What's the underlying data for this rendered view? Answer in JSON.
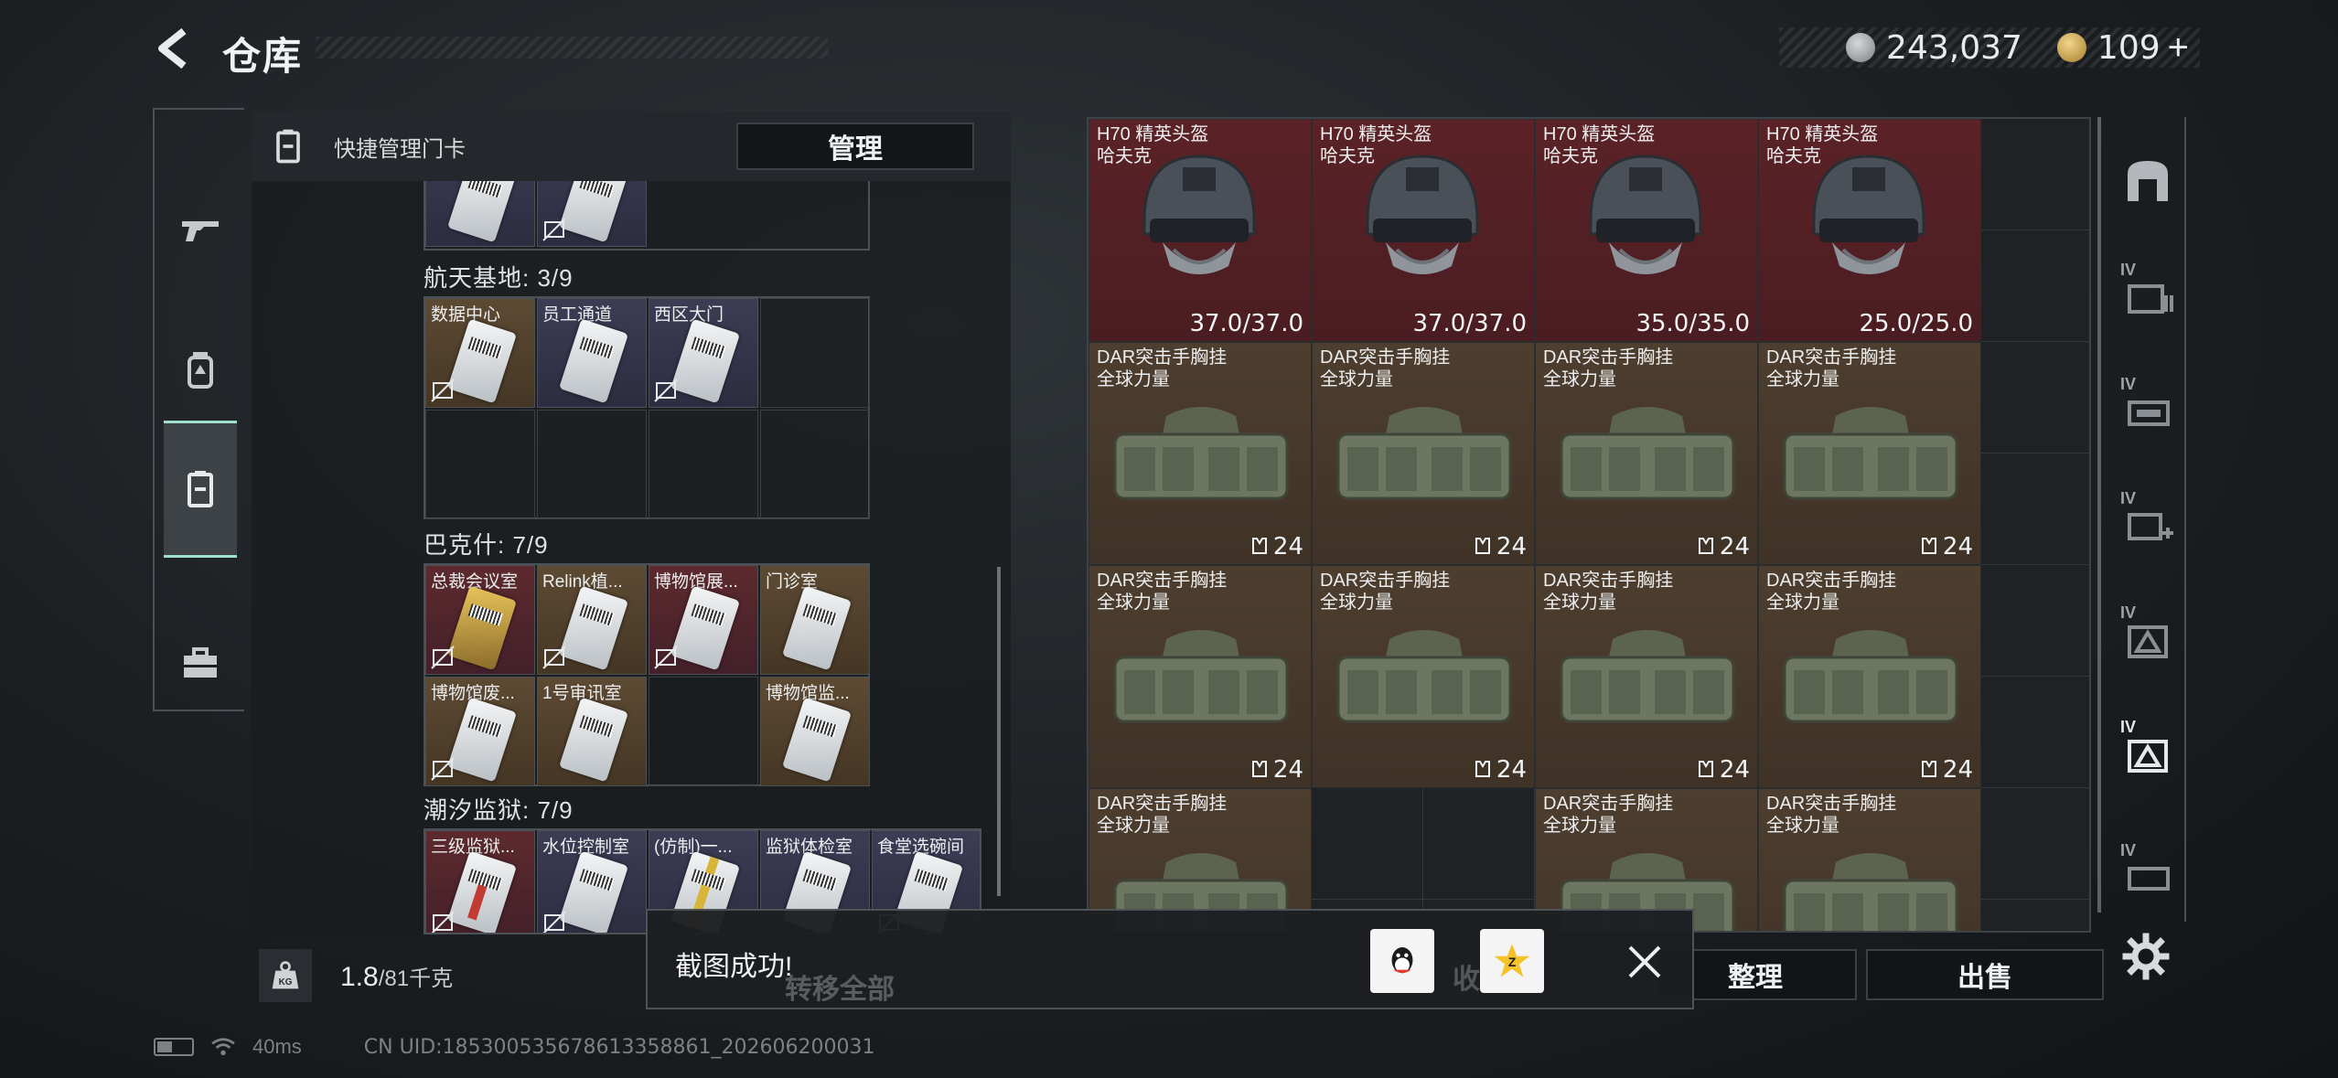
{
  "header": {
    "title": "仓库",
    "currency": [
      {
        "value": "243,037",
        "icon": "silver-coin-icon"
      },
      {
        "value": "109",
        "icon": "gold-coin-icon"
      }
    ],
    "plus": "+"
  },
  "card_panel": {
    "header_title": "快捷管理门卡",
    "manage_label": "管理",
    "sections": [
      {
        "title": "航天基地: 3/9",
        "cards": [
          "数据中心",
          "员工通道",
          "西区大门"
        ]
      },
      {
        "title": "巴克什: 7/9",
        "cards": [
          "总裁会议室",
          "Relink植...",
          "博物馆展...",
          "门诊室",
          "博物馆废...",
          "1号审讯室",
          "博物馆监..."
        ]
      },
      {
        "title": "潮汐监狱: 7/9",
        "cards": [
          "三级监狱...",
          "水位控制室",
          "(仿制)一...",
          "监狱体检室",
          "食堂选碗间"
        ]
      }
    ]
  },
  "weight": {
    "current": "1.8",
    "max": "/81千克"
  },
  "storage": {
    "helmets": [
      {
        "name_line1": "H70 精英头盔",
        "name_line2": "哈夫克",
        "durability": "37.0/37.0"
      },
      {
        "name_line1": "H70 精英头盔",
        "name_line2": "哈夫克",
        "durability": "37.0/37.0"
      },
      {
        "name_line1": "H70 精英头盔",
        "name_line2": "哈夫克",
        "durability": "35.0/35.0"
      },
      {
        "name_line1": "H70 精英头盔",
        "name_line2": "哈夫克",
        "durability": "25.0/25.0"
      }
    ],
    "vest_name_line1": "DAR突击手胸挂",
    "vest_name_line2": "全球力量",
    "vest_capacity": "24"
  },
  "buttons": {
    "organize": "整理",
    "sell": "出售",
    "transfer_all": "转移全部",
    "collect": "收藏"
  },
  "toast": {
    "message": "截图成功!"
  },
  "status": {
    "ping": "40ms",
    "uid": "CN UID:18530053567861335886​1_202606200031"
  },
  "colors": {
    "accent": "#9fe0c8",
    "helmet_bg": "#5b2227",
    "vest_bg": "#4d3e2f",
    "keycard_purple": "#3d3c55",
    "keycard_gold": "#5d4a33",
    "keycard_red": "#5d2a2e"
  }
}
